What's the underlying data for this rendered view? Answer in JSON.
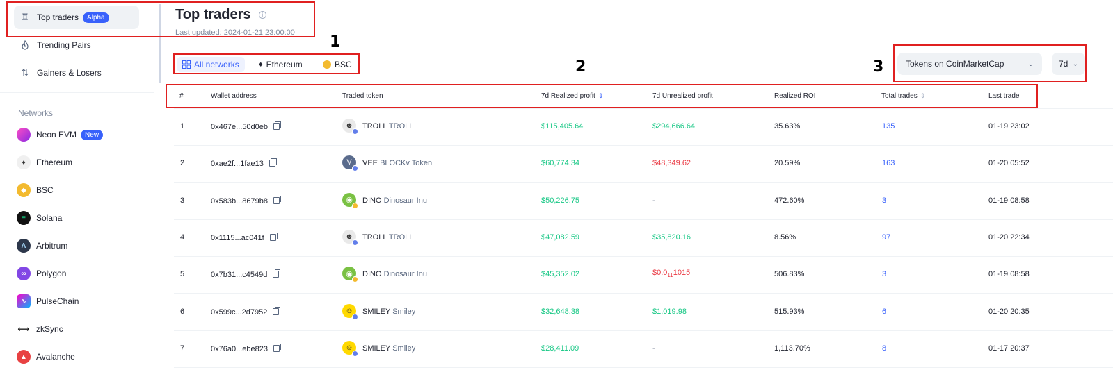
{
  "sidebar": {
    "nav": [
      {
        "label": "Top traders",
        "badge": "Alpha",
        "icon": "trophy-icon"
      },
      {
        "label": "Trending Pairs",
        "icon": "flame-icon"
      },
      {
        "label": "Gainers & Losers",
        "icon": "up-down-arrows-icon"
      }
    ],
    "networks_label": "Networks",
    "networks": [
      {
        "label": "Neon EVM",
        "badge": "New",
        "color": "#d724ff"
      },
      {
        "label": "Ethereum",
        "color": "#627eea"
      },
      {
        "label": "BSC",
        "color": "#f3ba2f"
      },
      {
        "label": "Solana",
        "color": "#111111"
      },
      {
        "label": "Arbitrum",
        "color": "#2d374b"
      },
      {
        "label": "Polygon",
        "color": "#8247e5"
      },
      {
        "label": "PulseChain",
        "color": "#e6007a"
      },
      {
        "label": "zkSync",
        "color": "#1e1e1e"
      },
      {
        "label": "Avalanche",
        "color": "#e84142"
      }
    ]
  },
  "header": {
    "title": "Top traders",
    "last_updated": "Last updated: 2024-01-21 23:00:00"
  },
  "network_tabs": [
    {
      "label": "All networks",
      "active": true
    },
    {
      "label": "Ethereum",
      "active": false
    },
    {
      "label": "BSC",
      "active": false
    }
  ],
  "filters": {
    "token_source": "Tokens on CoinMarketCap",
    "period": "7d"
  },
  "annotations": [
    "1",
    "2",
    "3"
  ],
  "table": {
    "columns": [
      "#",
      "Wallet address",
      "Traded token",
      "7d Realized profit",
      "7d Unrealized profit",
      "Realized ROI",
      "Total trades",
      "Last trade"
    ],
    "rows": [
      {
        "rank": "1",
        "wallet": "0x467e...50d0eb",
        "symbol": "TROLL",
        "name": "TROLL",
        "logo": "troll",
        "realized": "$115,405.64",
        "unrealized": "$294,666.64",
        "unrealized_color": "green",
        "roi": "35.63%",
        "trades": "135",
        "last": "01-19 23:02"
      },
      {
        "rank": "2",
        "wallet": "0xae2f...1fae13",
        "symbol": "VEE",
        "name": "BLOCKv Token",
        "logo": "vee",
        "realized": "$60,774.34",
        "unrealized": "$48,349.62",
        "unrealized_color": "red",
        "roi": "20.59%",
        "trades": "163",
        "last": "01-20 05:52"
      },
      {
        "rank": "3",
        "wallet": "0x583b...8679b8",
        "symbol": "DINO",
        "name": "Dinosaur Inu",
        "logo": "dino",
        "realized": "$50,226.75",
        "unrealized": "-",
        "unrealized_color": "grey",
        "roi": "472.60%",
        "trades": "3",
        "last": "01-19 08:58"
      },
      {
        "rank": "4",
        "wallet": "0x1115...ac041f",
        "symbol": "TROLL",
        "name": "TROLL",
        "logo": "troll",
        "realized": "$47,082.59",
        "unrealized": "$35,820.16",
        "unrealized_color": "green",
        "roi": "8.56%",
        "trades": "97",
        "last": "01-20 22:34"
      },
      {
        "rank": "5",
        "wallet": "0x7b31...c4549d",
        "symbol": "DINO",
        "name": "Dinosaur Inu",
        "logo": "dino",
        "realized": "$45,352.02",
        "unrealized": "$0.0",
        "unrealized_sub": "11",
        "unrealized_tail": "1015",
        "unrealized_color": "red",
        "roi": "506.83%",
        "trades": "3",
        "last": "01-19 08:58"
      },
      {
        "rank": "6",
        "wallet": "0x599c...2d7952",
        "symbol": "SMILEY",
        "name": "Smiley",
        "logo": "smiley",
        "realized": "$32,648.38",
        "unrealized": "$1,019.98",
        "unrealized_color": "green",
        "roi": "515.93%",
        "trades": "6",
        "last": "01-20 20:35"
      },
      {
        "rank": "7",
        "wallet": "0x76a0...ebe823",
        "symbol": "SMILEY",
        "name": "Smiley",
        "logo": "smiley",
        "realized": "$28,411.09",
        "unrealized": "-",
        "unrealized_color": "grey",
        "roi": "1,113.70%",
        "trades": "8",
        "last": "01-17 20:37"
      }
    ]
  }
}
